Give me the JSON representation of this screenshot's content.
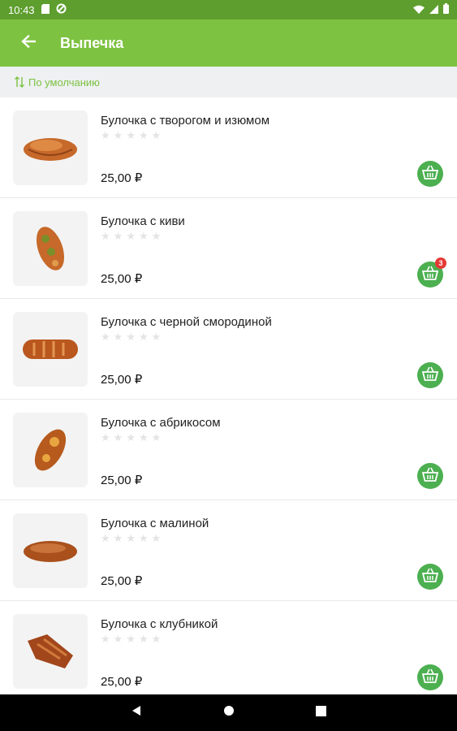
{
  "status_bar": {
    "time": "10:43"
  },
  "app_bar": {
    "title": "Выпечка"
  },
  "sort": {
    "label": "По умолчанию"
  },
  "products": [
    {
      "name": "Булочка с творогом и изюмом",
      "price": "25,00 ₽",
      "cart_count": ""
    },
    {
      "name": "Булочка с киви",
      "price": "25,00 ₽",
      "cart_count": "3"
    },
    {
      "name": "Булочка с черной смородиной",
      "price": "25,00 ₽",
      "cart_count": ""
    },
    {
      "name": "Булочка с абрикосом",
      "price": "25,00 ₽",
      "cart_count": ""
    },
    {
      "name": "Булочка с малиной",
      "price": "25,00 ₽",
      "cart_count": ""
    },
    {
      "name": "Булочка с клубникой",
      "price": "25,00 ₽",
      "cart_count": ""
    }
  ],
  "colors": {
    "primary": "#7dc241",
    "status": "#5e9e2e",
    "cart": "#4caf50",
    "badge": "#e53935"
  }
}
